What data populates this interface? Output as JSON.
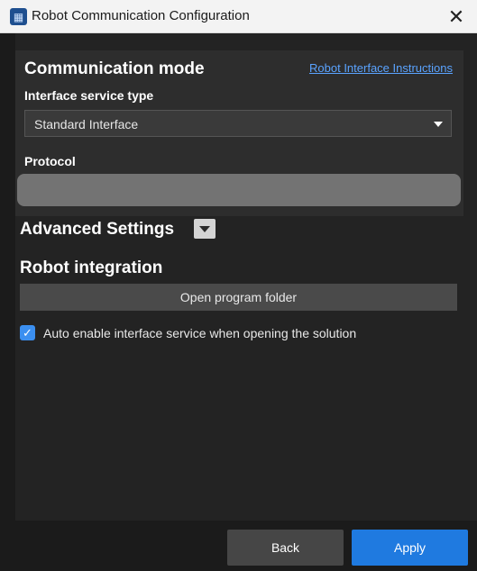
{
  "window": {
    "title": "Robot Communication Configuration",
    "close_glyph": "✕"
  },
  "communication": {
    "section_title": "Communication mode",
    "instructions_link": "Robot Interface Instructions",
    "interface_label": "Interface service type",
    "interface_value": "Standard Interface",
    "protocol_label": "Protocol",
    "protocol_value": ""
  },
  "advanced": {
    "title": "Advanced Settings"
  },
  "robot_integration": {
    "title": "Robot integration",
    "open_folder_label": "Open program folder",
    "auto_enable_label": "Auto enable interface service when opening the solution",
    "auto_enable_checked": true
  },
  "footer": {
    "back_label": "Back",
    "apply_label": "Apply"
  },
  "colors": {
    "accent": "#1f7ae0",
    "link": "#5aa3ff",
    "checkbox": "#3b8ff0"
  },
  "icons": {
    "app": "robot-app-icon",
    "close": "close-icon",
    "dropdown": "chevron-down-icon",
    "advanced_toggle": "caret-down-icon",
    "checkbox": "checkmark-icon"
  }
}
